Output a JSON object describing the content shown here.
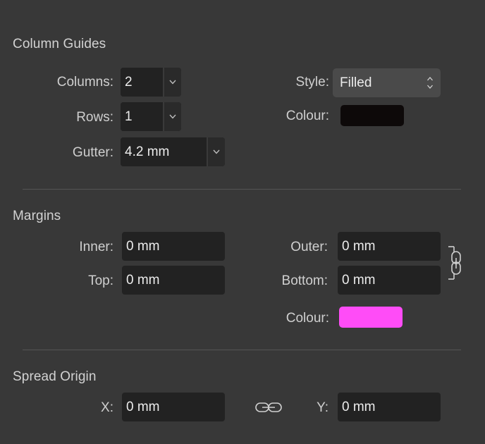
{
  "column_guides": {
    "title": "Column Guides",
    "columns_label": "Columns:",
    "columns_value": "2",
    "rows_label": "Rows:",
    "rows_value": "1",
    "gutter_label": "Gutter:",
    "gutter_value": "4.2 mm",
    "style_label": "Style:",
    "style_value": "Filled",
    "colour_label": "Colour:",
    "colour_value": "#0d0909"
  },
  "margins": {
    "title": "Margins",
    "inner_label": "Inner:",
    "inner_value": "0 mm",
    "top_label": "Top:",
    "top_value": "0 mm",
    "outer_label": "Outer:",
    "outer_value": "0 mm",
    "bottom_label": "Bottom:",
    "bottom_value": "0 mm",
    "colour_label": "Colour:",
    "colour_value": "#ff4cf7",
    "link_icon": "chain-link-vertical-icon"
  },
  "spread_origin": {
    "title": "Spread Origin",
    "x_label": "X:",
    "x_value": "0 mm",
    "y_label": "Y:",
    "y_value": "0 mm",
    "link_icon": "chain-link-horizontal-icon"
  },
  "colors": {
    "panel_bg": "#383838",
    "field_bg": "#222222",
    "select_bg": "#4a4a4a"
  }
}
